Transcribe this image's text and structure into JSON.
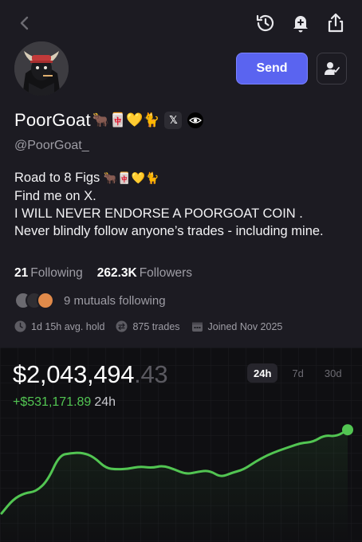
{
  "profile": {
    "display_name": "PoorGoat",
    "name_emojis": "🐂🀄💛🐈",
    "x_badge": "𝕏",
    "handle": "@PoorGoat_",
    "send_label": "Send"
  },
  "bio": {
    "line1_text": "Road to 8 Figs ",
    "line1_emojis": "🐂🀄💛🐈",
    "line2": "Find me on X.",
    "line3": "I WILL NEVER ENDORSE A POORGOAT COIN .",
    "line4": "Never blindly follow anyone’s trades - including mine."
  },
  "stats": {
    "following_count": "21",
    "following_label": "Following",
    "followers_count": "262.3K",
    "followers_label": "Followers"
  },
  "mutuals": {
    "text": "9 mutuals following"
  },
  "meta": {
    "avg_hold": "1d 15h avg. hold",
    "trades": "875 trades",
    "joined": "Joined Nov 2025"
  },
  "portfolio": {
    "balance_main": "$2,043,494",
    "balance_cents": ".43",
    "pnl_value": "+$531,171.89",
    "pnl_period": "24h",
    "timeframes": [
      "24h",
      "7d",
      "30d"
    ],
    "active_timeframe": "24h"
  },
  "colors": {
    "accent": "#5a64f0",
    "positive": "#52c552",
    "background": "#1c1b22",
    "chart_background": "#0f0f12"
  },
  "chart_data": {
    "type": "line",
    "series": [
      {
        "values": [
          1510000,
          1600000,
          1640000,
          1650000,
          1720000,
          1880000,
          1895000,
          1898000,
          1870000,
          1800000,
          1790000,
          1795000,
          1810000,
          1800000,
          1815000,
          1790000,
          1760000,
          1775000,
          1785000,
          1740000,
          1770000,
          1790000,
          1840000,
          1880000,
          1910000,
          1935000,
          1960000,
          1965000,
          2010000,
          2000000,
          2043494
        ]
      }
    ],
    "ylim": [
      1480000,
      2080000
    ],
    "grid": false,
    "title": "",
    "xlabel": "",
    "ylabel": ""
  }
}
